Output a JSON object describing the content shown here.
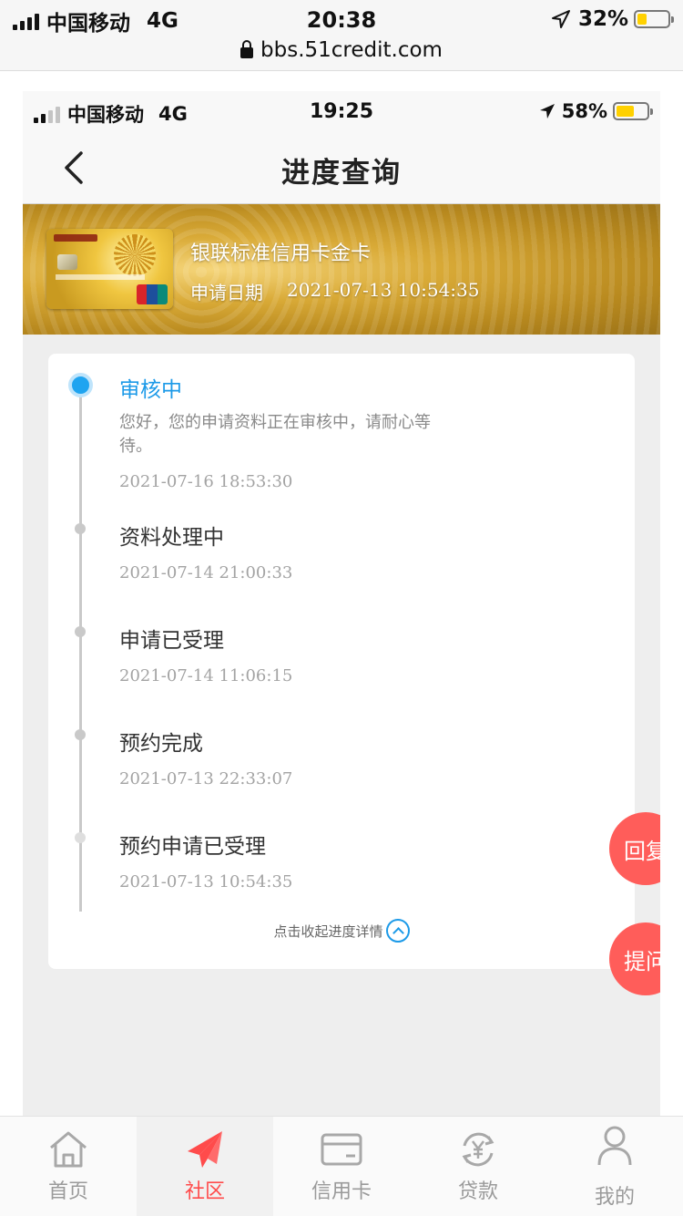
{
  "browser": {
    "carrier": "中国移动",
    "network": "4G",
    "time": "20:38",
    "battery": "32%",
    "battery_level": 0.32,
    "url": "bbs.51credit.com"
  },
  "app": {
    "status": {
      "carrier": "中国移动",
      "network": "4G",
      "time": "19:25",
      "battery": "58%",
      "battery_level": 0.58
    },
    "nav": {
      "title": "进度查询",
      "back_icon": "chevron-left-icon"
    },
    "card": {
      "name": "银联标准信用卡金卡",
      "date_label": "申请日期",
      "date": "2021-07-13 10:54:35"
    },
    "timeline": [
      {
        "title": "审核中",
        "desc": "您好，您的申请资料正在审核中，请耐心等待。",
        "time": "2021-07-16 18:53:30"
      },
      {
        "title": "资料处理中",
        "time": "2021-07-14 21:00:33"
      },
      {
        "title": "申请已受理",
        "time": "2021-07-14 11:06:15"
      },
      {
        "title": "预约完成",
        "time": "2021-07-13 22:33:07"
      },
      {
        "title": "预约申请已受理",
        "time": "2021-07-13 10:54:35"
      }
    ],
    "collapse_label": "点击收起进度详情",
    "fab": {
      "reply": "回复",
      "ask": "提问"
    },
    "colors": {
      "active_blue": "#1c9ae8",
      "fab_red": "#ff5d5a",
      "tab_active": "#ff4b4b"
    }
  },
  "tabs": [
    {
      "label": "首页",
      "icon": "home-icon"
    },
    {
      "label": "社区",
      "icon": "paper-plane-icon",
      "active": true
    },
    {
      "label": "信用卡",
      "icon": "credit-card-icon"
    },
    {
      "label": "贷款",
      "icon": "yen-refresh-icon"
    },
    {
      "label": "我的",
      "icon": "user-icon"
    }
  ]
}
